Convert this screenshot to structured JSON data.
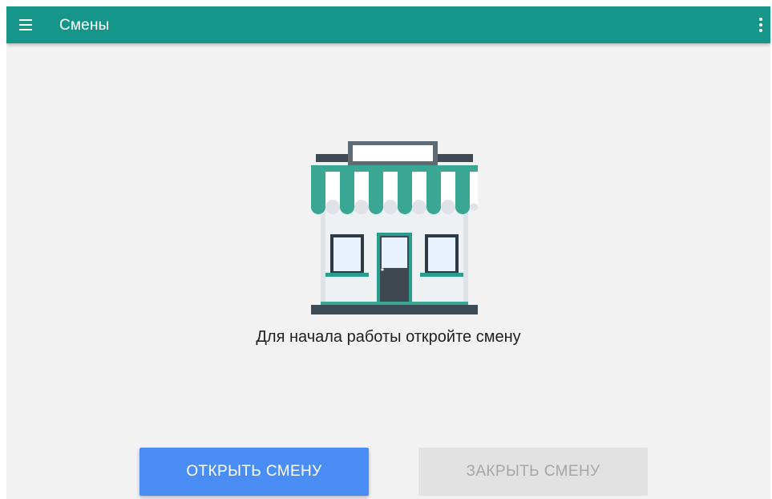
{
  "app_bar": {
    "title": "Смены",
    "menu_icon": "hamburger-menu-icon",
    "overflow_icon": "more-vert-icon",
    "color": "#16958a"
  },
  "empty_state": {
    "illustration": "storefront-icon",
    "message": "Для начала работы откройте смену"
  },
  "actions": {
    "open_shift": {
      "label": "ОТКРЫТЬ СМЕНУ",
      "color": "#4a8ef5",
      "enabled": true
    },
    "close_shift": {
      "label": "ЗАКРЫТЬ СМЕНУ",
      "color": "#e2e2e2",
      "enabled": false
    }
  }
}
